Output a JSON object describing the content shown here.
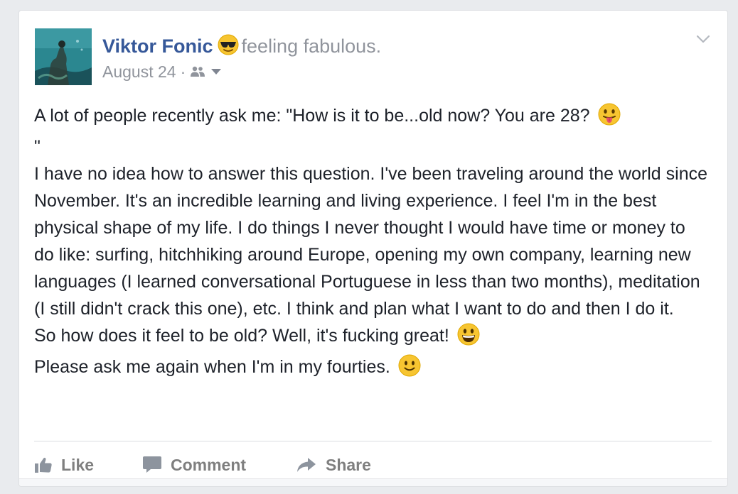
{
  "post": {
    "author": "Viktor Fonic",
    "feeling": "feeling fabulous.",
    "feeling_icon": "sunglasses-emoji-icon",
    "date": "August 24",
    "meta_separator": "·",
    "audience_icon": "friends-audience-icon",
    "body": {
      "line1": "A lot of people recently ask me: \"How is it to be...old now? You are 28?",
      "line1_tail": "\"",
      "paragraph": "I have no idea how to answer this question. I've been traveling around the world since November. It's an incredible learning and living experience. I feel I'm in the best physical shape of my life. I do things I never thought I would have time or money to do like: surfing, hitchhiking around Europe, opening my own company, learning new languages (I learned conversational Portuguese in less than two months), meditation (I still didn't crack this one), etc. I think and plan what I want to do and then I do it.",
      "line3": "So how does it feel to be old? Well, it's fucking great!",
      "line4": "Please ask me again when I'm in my fourties."
    }
  },
  "actions": {
    "like": "Like",
    "comment": "Comment",
    "share": "Share"
  },
  "colors": {
    "author_link": "#365899",
    "muted": "#90949c",
    "body_text": "#1d2129",
    "action_text": "#7f7f7f",
    "emoji_yellow": "#f7c531"
  }
}
